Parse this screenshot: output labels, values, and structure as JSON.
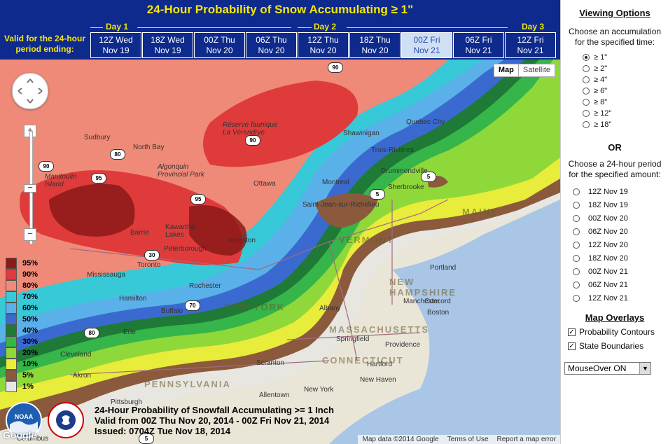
{
  "header": {
    "title": "24-Hour Probability of Snow Accumulating ≥ 1\"",
    "valid_label_line1": "Valid for the 24-hour",
    "valid_label_line2": "period ending:",
    "days": [
      "Day 1",
      "Day 2",
      "Day 3"
    ],
    "periods": [
      {
        "line1": "12Z Wed",
        "line2": "Nov 19",
        "selected": false
      },
      {
        "line1": "18Z Wed",
        "line2": "Nov 19",
        "selected": false
      },
      {
        "line1": "00Z Thu",
        "line2": "Nov 20",
        "selected": false
      },
      {
        "line1": "06Z Thu",
        "line2": "Nov 20",
        "selected": false
      },
      {
        "line1": "12Z Thu",
        "line2": "Nov 20",
        "selected": false
      },
      {
        "line1": "18Z Thu",
        "line2": "Nov 20",
        "selected": false
      },
      {
        "line1": "00Z Fri",
        "line2": "Nov 21",
        "selected": true
      },
      {
        "line1": "06Z Fri",
        "line2": "Nov 21",
        "selected": false
      },
      {
        "line1": "12Z Fri",
        "line2": "Nov 21",
        "selected": false
      }
    ]
  },
  "map": {
    "maptype_map": "Map",
    "maptype_satellite": "Satellite",
    "zoom_in": "+",
    "zoom_out": "−",
    "legend": [
      {
        "label": "95%",
        "color": "#8b1a1a"
      },
      {
        "label": "90%",
        "color": "#e03b3b"
      },
      {
        "label": "80%",
        "color": "#f08a78"
      },
      {
        "label": "70%",
        "color": "#38c9d8"
      },
      {
        "label": "60%",
        "color": "#5ab0e8"
      },
      {
        "label": "50%",
        "color": "#3a6ad0"
      },
      {
        "label": "40%",
        "color": "#1e7a36"
      },
      {
        "label": "30%",
        "color": "#35b54a"
      },
      {
        "label": "20%",
        "color": "#8fd83a"
      },
      {
        "label": "10%",
        "color": "#e8ec3a"
      },
      {
        "label": "5%",
        "color": "#8b5a3c"
      },
      {
        "label": "1%",
        "color": "#e6e6e6"
      }
    ],
    "caption_line1": "24-Hour Probability of Snowfall Accumulating >= 1 Inch",
    "caption_line2": "Valid from 00Z Thu Nov 20, 2014 - 00Z Fri Nov 21, 2014",
    "caption_line3": "Issued: 0704Z Tue Nov 18, 2014",
    "noaa_text": "NOAA",
    "google_text": "Google",
    "attribution": [
      "Map data ©2014 Google",
      "Terms of Use",
      "Report a map error"
    ],
    "contour_labels": [
      "90",
      "90",
      "90",
      "95",
      "95",
      "80",
      "30",
      "70",
      "80",
      "5",
      "5",
      "5"
    ],
    "cities": [
      "Sudbury",
      "North Bay",
      "Réserve faunique La Vérendrye",
      "Algonquin Provincial Park",
      "Manitoulin Island",
      "Barrie",
      "Kawartha Lakes",
      "Peterborough",
      "Kingston",
      "Ottawa",
      "Montreal",
      "Sherbrooke",
      "Drummondville",
      "Trois-Rivières",
      "Shawinigan",
      "Quebec City",
      "Saint-Jean-sur-Richelieu",
      "Mississauga",
      "Toronto",
      "Hamilton",
      "Rochester",
      "Buffalo",
      "Erie",
      "Cleveland",
      "Akron",
      "Pittsburgh",
      "Columbus",
      "Scranton",
      "Allentown",
      "New York",
      "New Haven",
      "Hartford",
      "Springfield",
      "Providence",
      "Albany",
      "Manchester",
      "Concord",
      "Portland",
      "Boston"
    ],
    "states": [
      "VERMONT",
      "NEW HAMPSHIRE",
      "MAINE",
      "MASSACHUSETTS",
      "CONNECTICUT",
      "NEW YORK",
      "PENNSYLVANIA"
    ]
  },
  "sidebar": {
    "viewing_heading": "Viewing Options",
    "accum_text_line1": "Choose an accumulation",
    "accum_text_line2": "for the specified time:",
    "accumulations": [
      {
        "label": "≥ 1\"",
        "checked": true
      },
      {
        "label": "≥ 2\"",
        "checked": false
      },
      {
        "label": "≥ 4\"",
        "checked": false
      },
      {
        "label": "≥ 6\"",
        "checked": false
      },
      {
        "label": "≥ 8\"",
        "checked": false
      },
      {
        "label": "≥ 12\"",
        "checked": false
      },
      {
        "label": "≥ 18\"",
        "checked": false
      }
    ],
    "or_text": "OR",
    "period_text_line1": "Choose a 24-hour period",
    "period_text_line2": "for the specified amount:",
    "period_options": [
      "12Z Nov 19",
      "18Z Nov 19",
      "00Z Nov 20",
      "06Z Nov 20",
      "12Z Nov 20",
      "18Z Nov 20",
      "00Z Nov 21",
      "06Z Nov 21",
      "12Z Nov 21"
    ],
    "overlays_heading": "Map Overlays",
    "overlays": [
      {
        "label": "Probability Contours",
        "checked": true
      },
      {
        "label": "State Boundaries",
        "checked": true
      }
    ],
    "mouseover_value": "MouseOver ON"
  }
}
